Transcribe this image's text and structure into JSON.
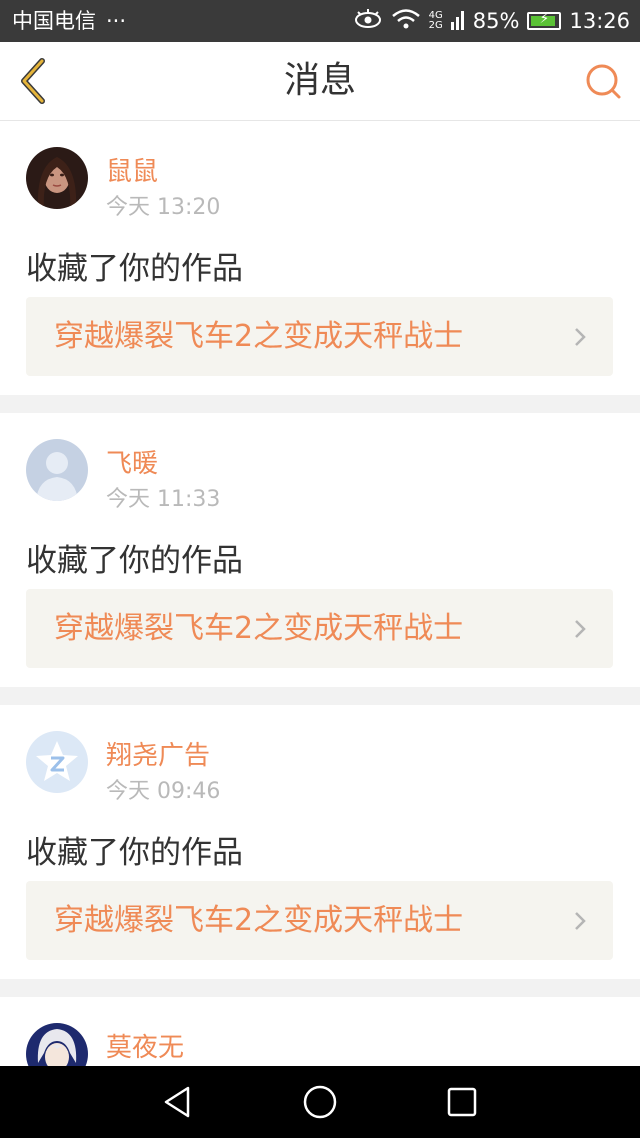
{
  "status_bar": {
    "carrier": "中国电信",
    "more": "···",
    "network_top": "4G",
    "network_bottom": "2G",
    "battery": "85%",
    "time": "13:26"
  },
  "header": {
    "title": "消息"
  },
  "colors": {
    "accent": "#ef8a56",
    "back_icon": "#e5b43a",
    "card_bg": "#f5f4ef"
  },
  "messages": [
    {
      "name": "鼠鼠",
      "time": "今天 13:20",
      "action": "收藏了你的作品",
      "work": "穿越爆裂飞车2之变成天秤战士",
      "avatar": "photo-avatar"
    },
    {
      "name": "飞暖",
      "time": "今天 11:33",
      "action": "收藏了你的作品",
      "work": "穿越爆裂飞车2之变成天秤战士",
      "avatar": "default-avatar"
    },
    {
      "name": "翔尧广告",
      "time": "今天 09:46",
      "action": "收藏了你的作品",
      "work": "穿越爆裂飞车2之变成天秤战士",
      "avatar": "qq-avatar"
    },
    {
      "name": "莫夜无",
      "avatar": "anime-avatar"
    }
  ],
  "nav_bar": {
    "icons": [
      "back-triangle-icon",
      "home-circle-icon",
      "recents-square-icon"
    ]
  }
}
